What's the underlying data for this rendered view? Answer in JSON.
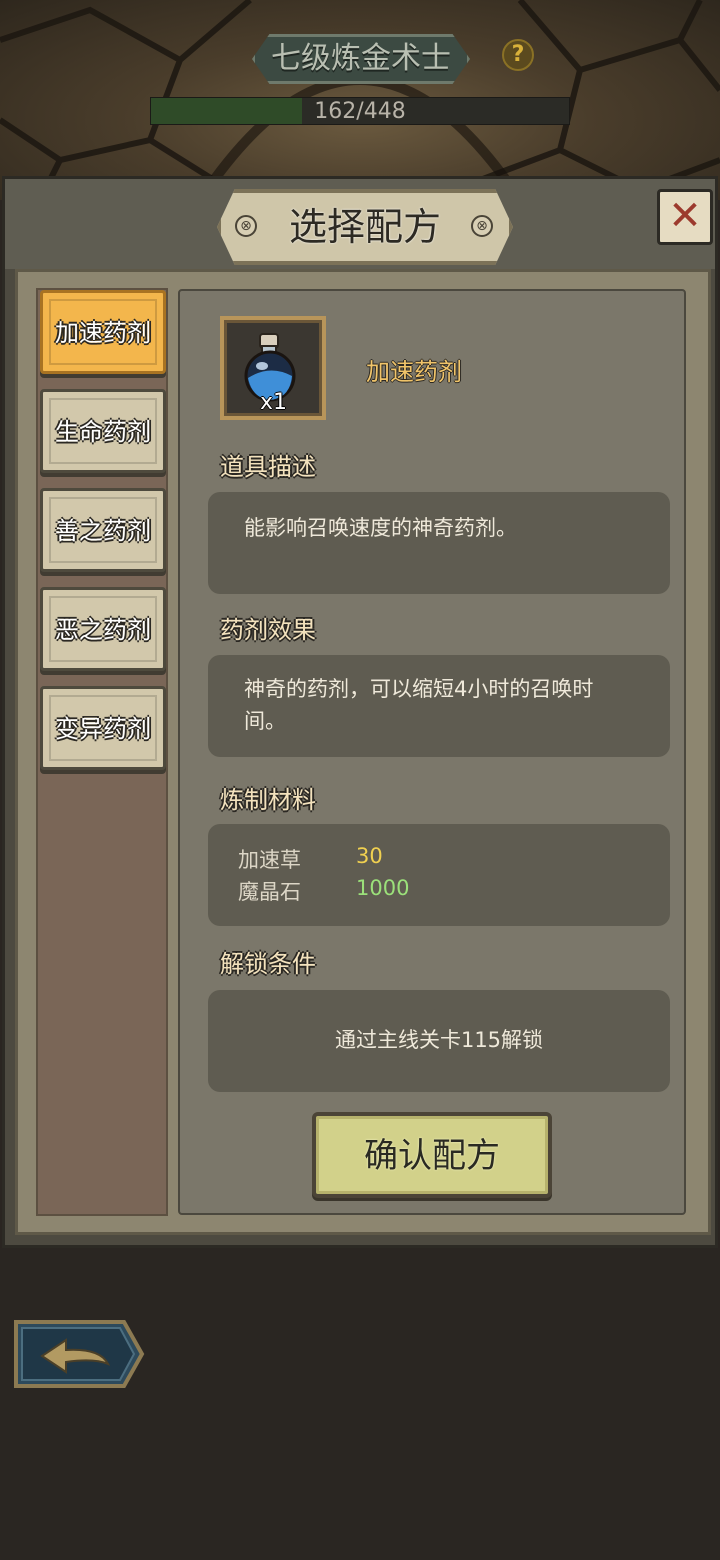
{
  "header": {
    "level_title": "七级炼金术士",
    "help_glyph": "?",
    "xp": {
      "current": 162,
      "max": 448,
      "text": "162/448"
    }
  },
  "dialog": {
    "title": "选择配方",
    "close_glyph": "✕"
  },
  "tabs": [
    {
      "label": "加速药剂",
      "active": true
    },
    {
      "label": "生命药剂",
      "active": false
    },
    {
      "label": "善之药剂",
      "active": false
    },
    {
      "label": "恶之药剂",
      "active": false
    },
    {
      "label": "变异药剂",
      "active": false
    }
  ],
  "item": {
    "name": "加速药剂",
    "quantity": "x1",
    "icon": "blue-potion-icon"
  },
  "sections": {
    "description": {
      "title": "道具描述",
      "text": "能影响召唤速度的神奇药剂。"
    },
    "effect": {
      "title": "药剂效果",
      "text": "神奇的药剂，可以缩短4小时的召唤时间。"
    },
    "materials": {
      "title": "炼制材料",
      "items": [
        {
          "name": "加速草",
          "amount": "30",
          "color": "#f0d050"
        },
        {
          "name": "魔晶石",
          "amount": "1000",
          "color": "#9be07a"
        }
      ]
    },
    "unlock": {
      "title": "解锁条件",
      "text": "通过主线关卡115解锁"
    }
  },
  "confirm_label": "确认配方",
  "colors": {
    "active_tab": "#f3b64c",
    "tab": "#d2c8ab",
    "xp_fill": "#2f4b28",
    "item_name": "#f0c46a"
  }
}
